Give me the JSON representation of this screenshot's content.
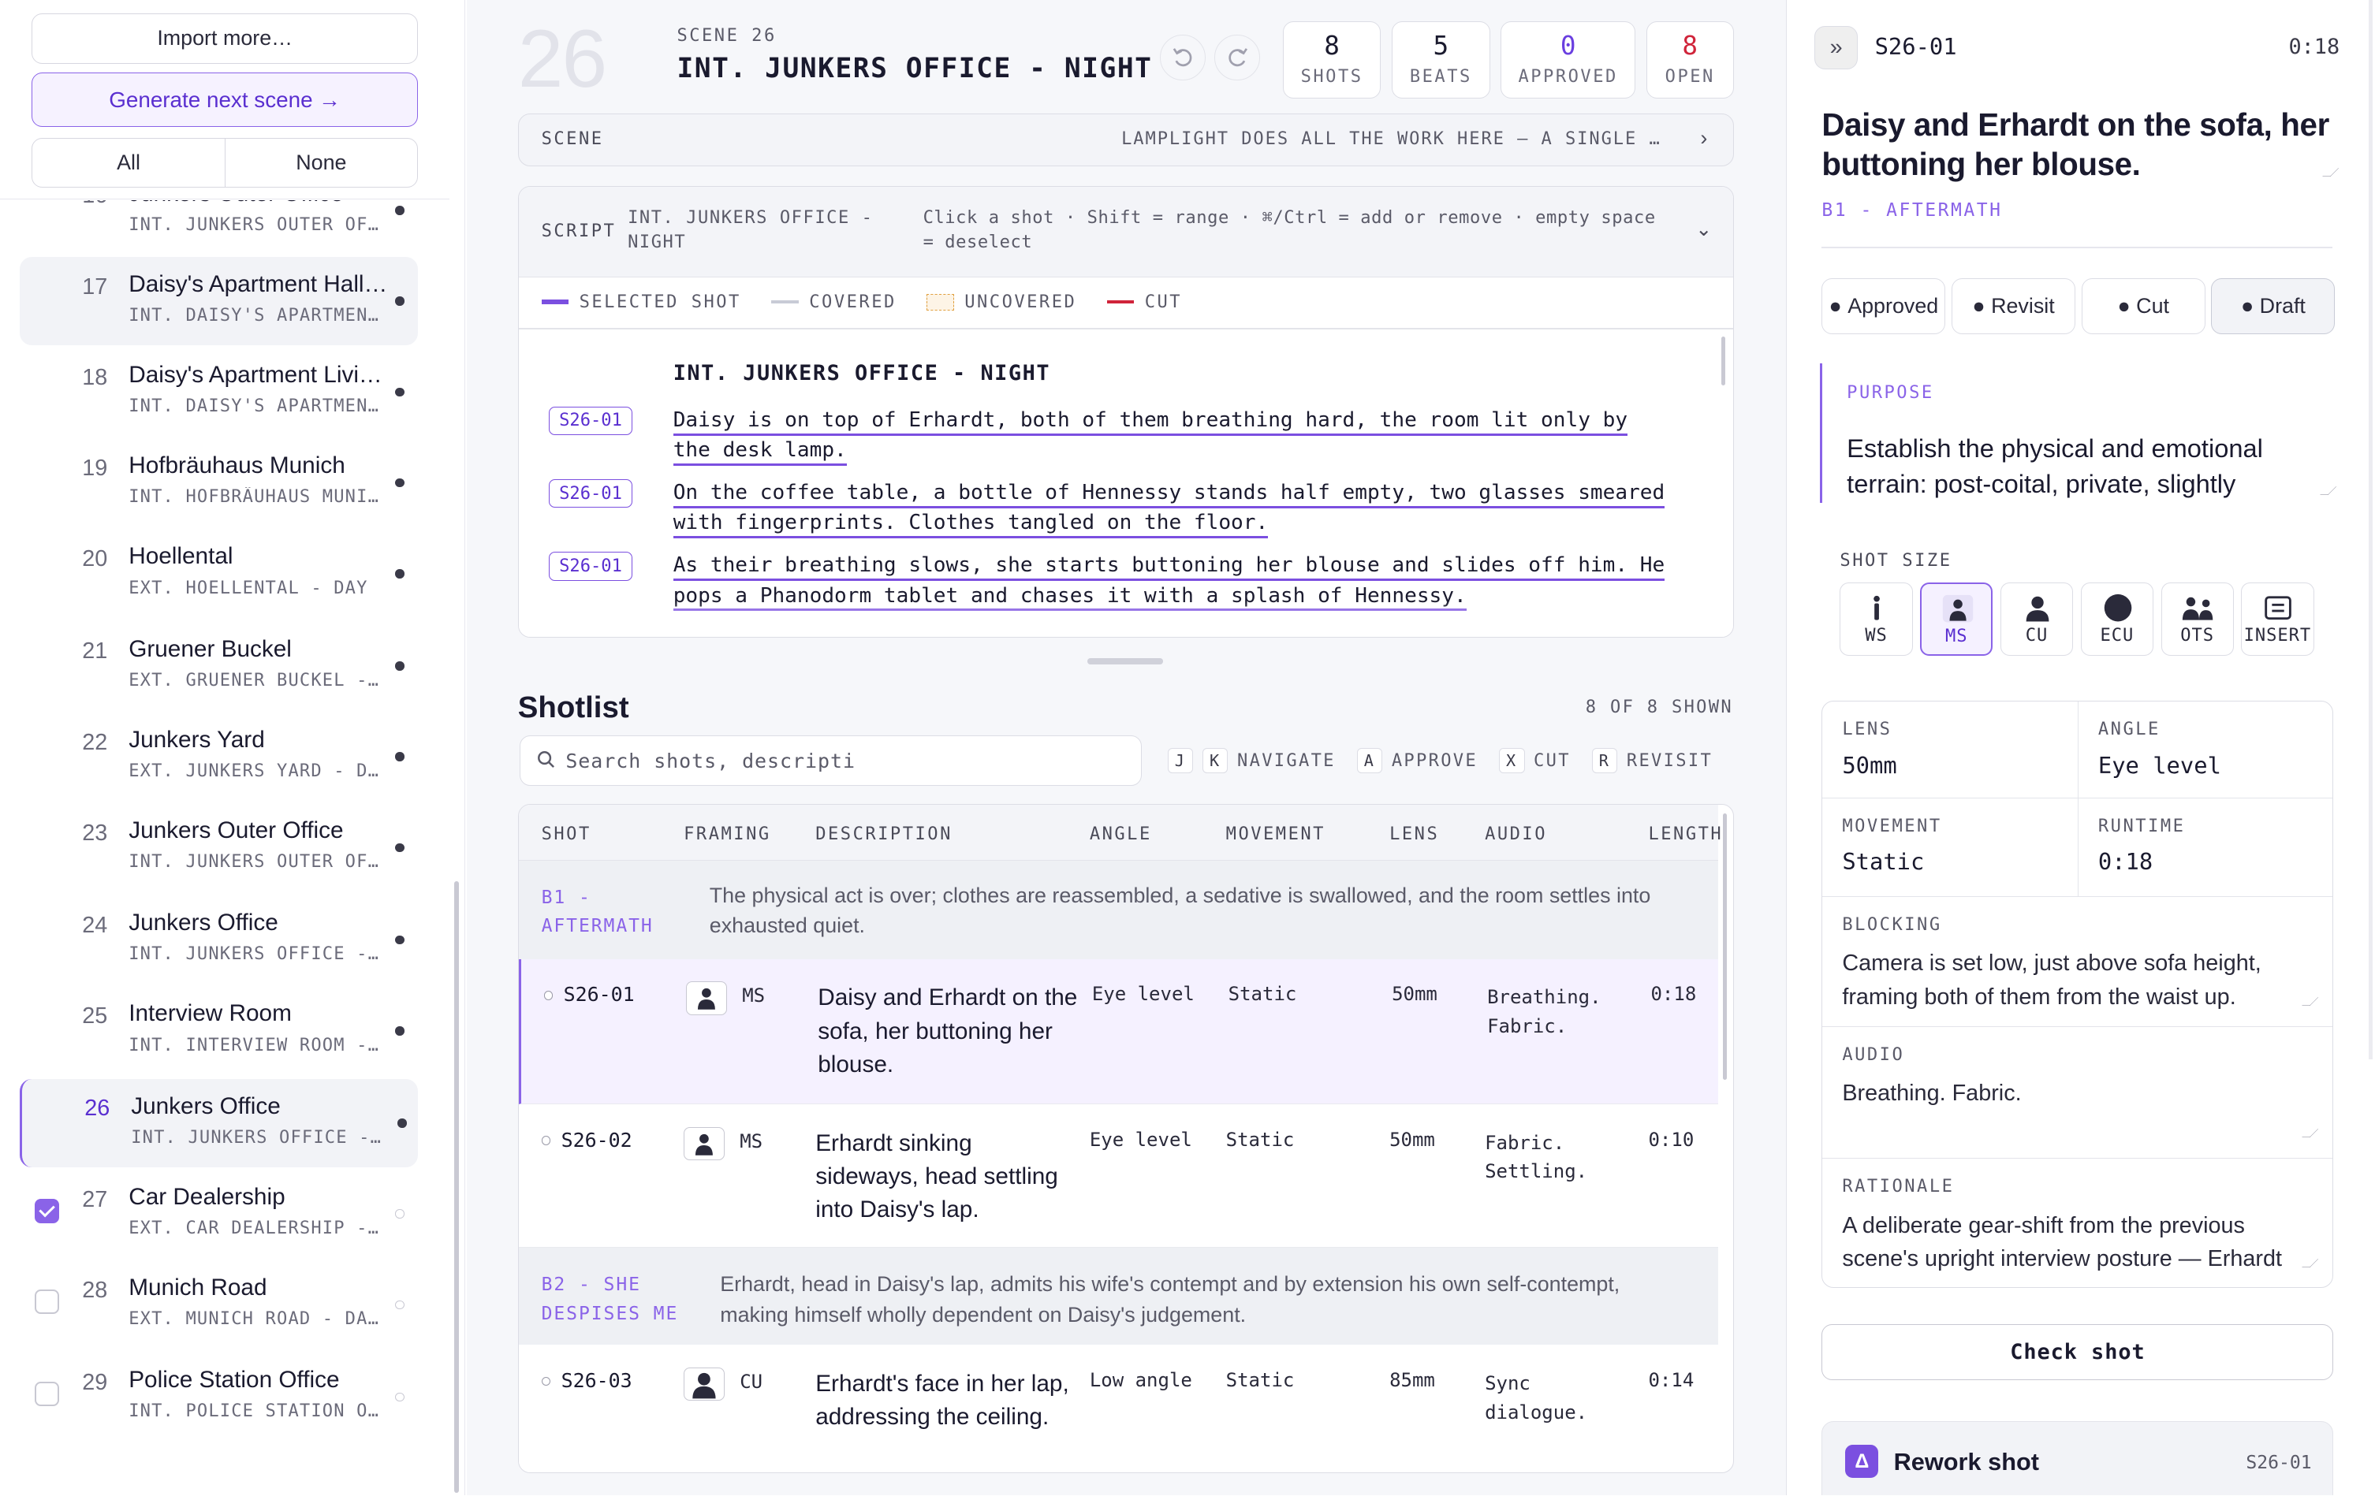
{
  "sidebar": {
    "import_label": "Import more…",
    "generate_label": "Generate next scene →",
    "filter_all": "All",
    "filter_none": "None",
    "scenes": [
      {
        "num": "16",
        "name": "Junkers Outer Office",
        "slug": "INT. JUNKERS OUTER OFF…",
        "state": "dot"
      },
      {
        "num": "17",
        "name": "Daisy's Apartment Hall…",
        "slug": "INT. DAISY'S APARTMENT…",
        "state": "dot"
      },
      {
        "num": "18",
        "name": "Daisy's Apartment Livi…",
        "slug": "INT. DAISY'S APARTMENT…",
        "state": "dot"
      },
      {
        "num": "19",
        "name": "Hofbräuhaus Munich",
        "slug": "INT. HOFBRÄUHAUS MUNIC…",
        "state": "dot"
      },
      {
        "num": "20",
        "name": "Hoellental",
        "slug": "EXT. HOELLENTAL - DAY",
        "state": "dot"
      },
      {
        "num": "21",
        "name": "Gruener Buckel",
        "slug": "EXT. GRUENER BUCKEL - …",
        "state": "dot"
      },
      {
        "num": "22",
        "name": "Junkers Yard",
        "slug": "EXT. JUNKERS YARD - DA…",
        "state": "dot"
      },
      {
        "num": "23",
        "name": "Junkers Outer Office",
        "slug": "INT. JUNKERS OUTER OFF…",
        "state": "dot"
      },
      {
        "num": "24",
        "name": "Junkers Office",
        "slug": "INT. JUNKERS OFFICE - …",
        "state": "dot"
      },
      {
        "num": "25",
        "name": "Interview Room",
        "slug": "INT. INTERVIEW ROOM - …",
        "state": "dot"
      },
      {
        "num": "26",
        "name": "Junkers Office",
        "slug": "INT. JUNKERS OFFICE - …",
        "state": "dot"
      },
      {
        "num": "27",
        "name": "Car Dealership",
        "slug": "EXT. CAR DEALERSHIP - …",
        "state": "checked"
      },
      {
        "num": "28",
        "name": "Munich Road",
        "slug": "EXT. MUNICH ROAD - DAY…",
        "state": "unchecked"
      },
      {
        "num": "29",
        "name": "Police Station Office",
        "slug": "INT. POLICE STATION OF…",
        "state": "unchecked"
      }
    ]
  },
  "scene": {
    "number": "26",
    "label": "SCENE 26",
    "title": "INT. JUNKERS OFFICE - NIGHT",
    "stats": [
      {
        "value": "8",
        "label": "SHOTS",
        "color": "#1a1a2e"
      },
      {
        "value": "5",
        "label": "BEATS",
        "color": "#1a1a2e"
      },
      {
        "value": "0",
        "label": "APPROVED",
        "color": "#6a3fe0"
      },
      {
        "value": "8",
        "label": "OPEN",
        "color": "#d0243a"
      }
    ],
    "bar_label": "SCENE",
    "bar_text": "LAMPLIGHT DOES ALL THE WORK HERE — A SINGLE DESK LAMP",
    "script_label": "SCRIPT",
    "script_slug": "INT. JUNKERS OFFICE - NIGHT",
    "script_hint": "Click a shot · Shift = range · ⌘/Ctrl = add or remove · empty space = deselect",
    "legend": [
      {
        "label": "SELECTED SHOT",
        "color": "#7b4fe0",
        "style": "solid"
      },
      {
        "label": "COVERED",
        "color": "#c8cbd6",
        "style": "solid"
      },
      {
        "label": "UNCOVERED",
        "color": "#e0a040",
        "style": "dashed"
      },
      {
        "label": "CUT",
        "color": "#d0243a",
        "style": "solid"
      }
    ],
    "script_heading": "INT. JUNKERS OFFICE - NIGHT",
    "script_lines": [
      {
        "tag": "S26-01",
        "text": "Daisy is on top of Erhardt, both of them breathing hard, the room lit only by the desk lamp."
      },
      {
        "tag": "S26-01",
        "text": "On the coffee table, a bottle of Hennessy stands half empty, two glasses smeared with fingerprints. Clothes tangled on the floor."
      },
      {
        "tag": "S26-01",
        "text": "As their breathing slows, she starts buttoning her blouse and slides off him. He pops a Phanodorm tablet and chases it with a splash of Hennessy."
      }
    ]
  },
  "shotlist": {
    "title": "Shotlist",
    "shown": "8 OF 8 SHOWN",
    "search_placeholder": "Search shots, descripti",
    "keys": [
      {
        "k1": "J",
        "k2": "K",
        "label": "NAVIGATE"
      },
      {
        "k1": "A",
        "label": "APPROVE"
      },
      {
        "k1": "X",
        "label": "CUT"
      },
      {
        "k1": "R",
        "label": "REVISIT"
      }
    ],
    "columns": [
      "SHOT",
      "FRAMING",
      "DESCRIPTION",
      "ANGLE",
      "MOVEMENT",
      "LENS",
      "AUDIO",
      "LENGTH"
    ],
    "beat1": {
      "label": "B1 - AFTERMATH",
      "desc": "The physical act is over; clothes are reassembled, a sedative is swallowed, and the room settles into exhausted quiet."
    },
    "beat2": {
      "label": "B2 - SHE DESPISES ME",
      "desc": "Erhardt, head in Daisy's lap, admits his wife's contempt and by extension his own self-contempt, making himself wholly dependent on Daisy's judgement."
    },
    "rows": [
      {
        "id": "S26-01",
        "framing": "MS",
        "desc": "Daisy and Erhardt on the sofa, her buttoning her blouse.",
        "angle": "Eye level",
        "movement": "Static",
        "lens": "50mm",
        "audio": "Breathing. Fabric.",
        "length": "0:18"
      },
      {
        "id": "S26-02",
        "framing": "MS",
        "desc": "Erhardt sinking sideways, head settling into Daisy's lap.",
        "angle": "Eye level",
        "movement": "Static",
        "lens": "50mm",
        "audio": "Fabric. Settling.",
        "length": "0:10"
      },
      {
        "id": "S26-03",
        "framing": "CU",
        "desc": "Erhardt's face in her lap, addressing the ceiling.",
        "angle": "Low angle",
        "movement": "Static",
        "lens": "85mm",
        "audio": "Sync dialogue.",
        "length": "0:14"
      }
    ]
  },
  "detail": {
    "shot_id": "S26-01",
    "runtime_top": "0:18",
    "title": "Daisy and Erhardt on the sofa, her buttoning her blouse.",
    "beat": "B1 - AFTERMATH",
    "statuses": [
      "Approved",
      "Revisit",
      "Cut",
      "Draft"
    ],
    "purpose_label": "PURPOSE",
    "purpose": "Establish the physical and emotional terrain: post-coital, private, slightly",
    "shot_size_label": "SHOT SIZE",
    "sizes": [
      "WS",
      "MS",
      "CU",
      "ECU",
      "OTS",
      "INSERT"
    ],
    "lens_label": "LENS",
    "lens": "50mm",
    "angle_label": "ANGLE",
    "angle": "Eye level",
    "movement_label": "MOVEMENT",
    "movement": "Static",
    "runtime_label": "RUNTIME",
    "runtime": "0:18",
    "blocking_label": "BLOCKING",
    "blocking": "Camera is set low, just above sofa height, framing both of them from the waist up.",
    "audio_label": "AUDIO",
    "audio": "Breathing. Fabric.",
    "rationale_label": "RATIONALE",
    "rationale": "A deliberate gear-shift from the previous scene's upright interview posture — Erhardt",
    "check_label": "Check shot",
    "rework_label": "Rework shot",
    "rework_id": "S26-01"
  }
}
